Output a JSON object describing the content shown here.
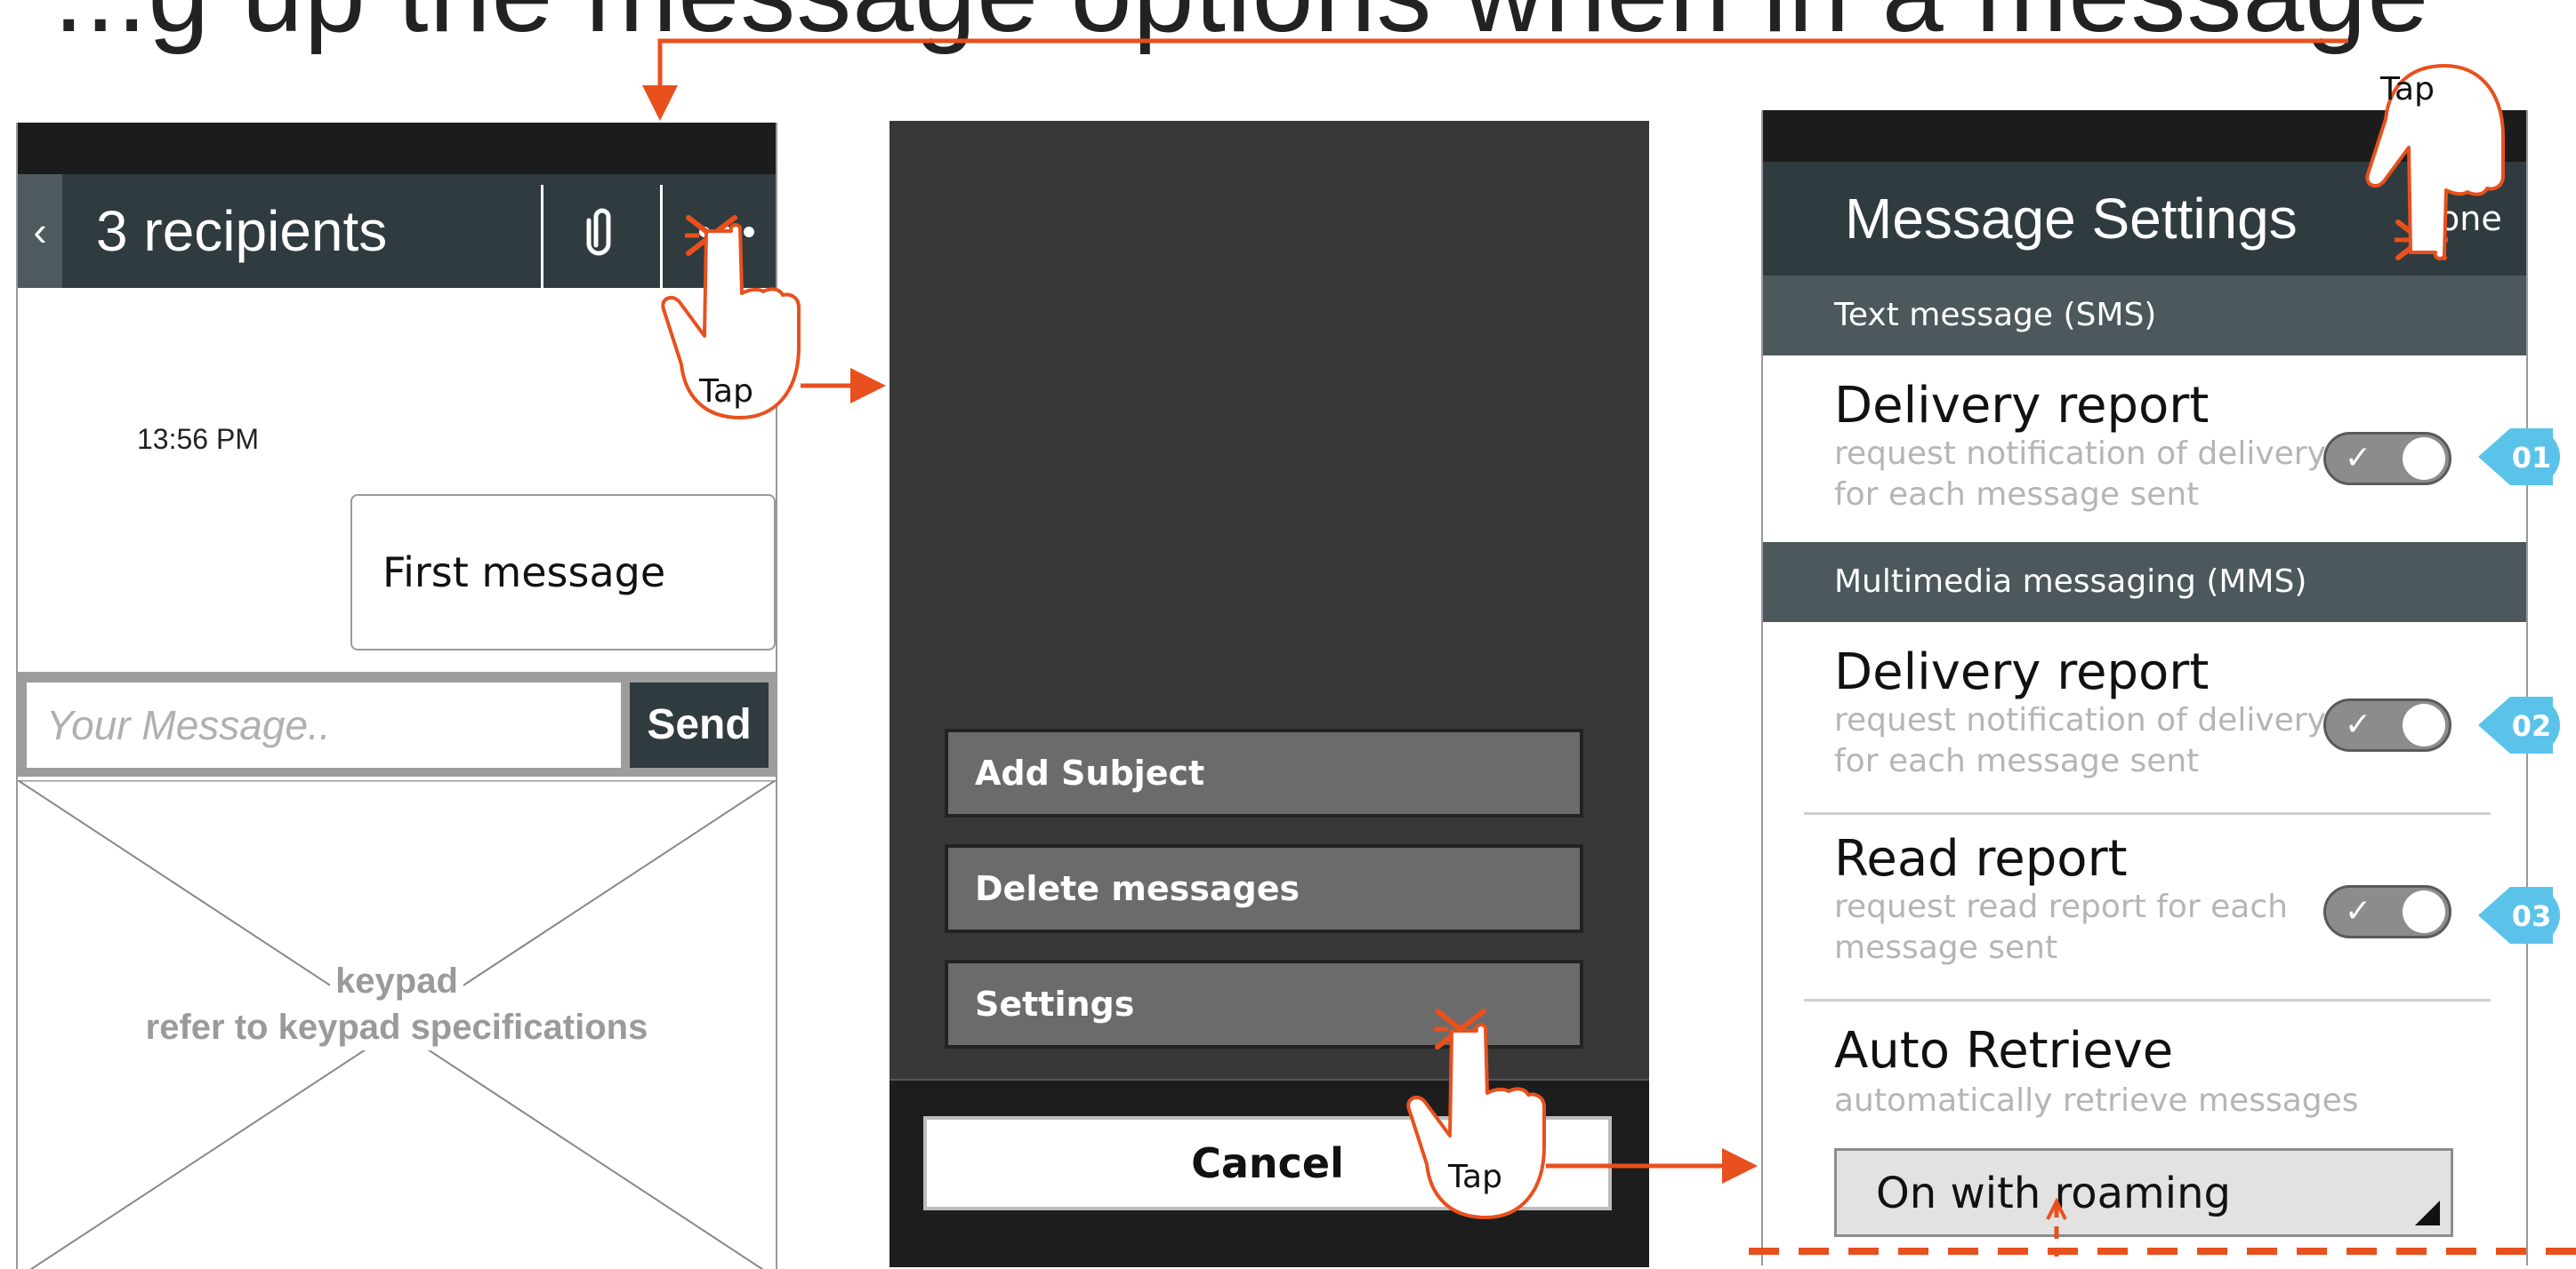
{
  "heading": "...g up the message options when in a message",
  "screen1": {
    "title": "3 recipients",
    "time": "13:56 PM",
    "message": "First message",
    "input_placeholder": "Your Message..",
    "send": "Send",
    "keypad_line1": "keypad",
    "keypad_line2": "refer to keypad specifications"
  },
  "screen2": {
    "menu_items": [
      "Add Subject",
      "Delete messages",
      "Settings"
    ],
    "cancel": "Cancel"
  },
  "screen3": {
    "title": "Message Settings",
    "done": "one",
    "sections": [
      "Text message (SMS)",
      "Multimedia messaging (MMS)"
    ],
    "settings": [
      {
        "label": "Delivery report",
        "desc1": "request notification of delivery",
        "desc2": "for each message sent",
        "badge": "01",
        "enabled": true
      },
      {
        "label": "Delivery report",
        "desc1": "request notification of delivery",
        "desc2": "for each message sent",
        "badge": "02",
        "enabled": true
      },
      {
        "label": "Read report",
        "desc1": "request read report for each",
        "desc2": "message sent",
        "badge": "03",
        "enabled": true
      }
    ],
    "auto_retrieve": {
      "label": "Auto Retrieve",
      "desc": "automatically retrieve messages",
      "value": "On with roaming"
    }
  },
  "annotations": {
    "tap": "Tap"
  },
  "colors": {
    "accent": "#e8501e",
    "badge": "#5bc3ea",
    "header": "#2f3b3f",
    "section": "#4c585c"
  }
}
